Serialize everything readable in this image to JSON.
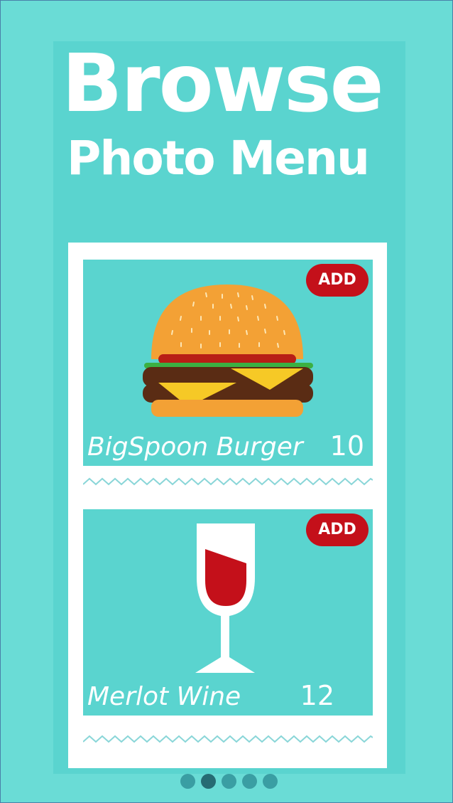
{
  "header": {
    "title_line1": "Browse",
    "title_line2": "Photo Menu"
  },
  "menu": {
    "items": [
      {
        "name": "BigSpoon Burger",
        "price": "10",
        "add_label": "ADD",
        "icon": "burger-icon"
      },
      {
        "name": "Merlot Wine",
        "price": "12",
        "add_label": "ADD",
        "icon": "wine-glass-icon"
      }
    ]
  },
  "pagination": {
    "count": 5,
    "active_index": 1
  },
  "colors": {
    "background": "#6adcd6",
    "panel": "#5ad4cf",
    "add_button": "#c4101a",
    "active_dot": "#266b73",
    "dot": "#3a9ea3"
  }
}
